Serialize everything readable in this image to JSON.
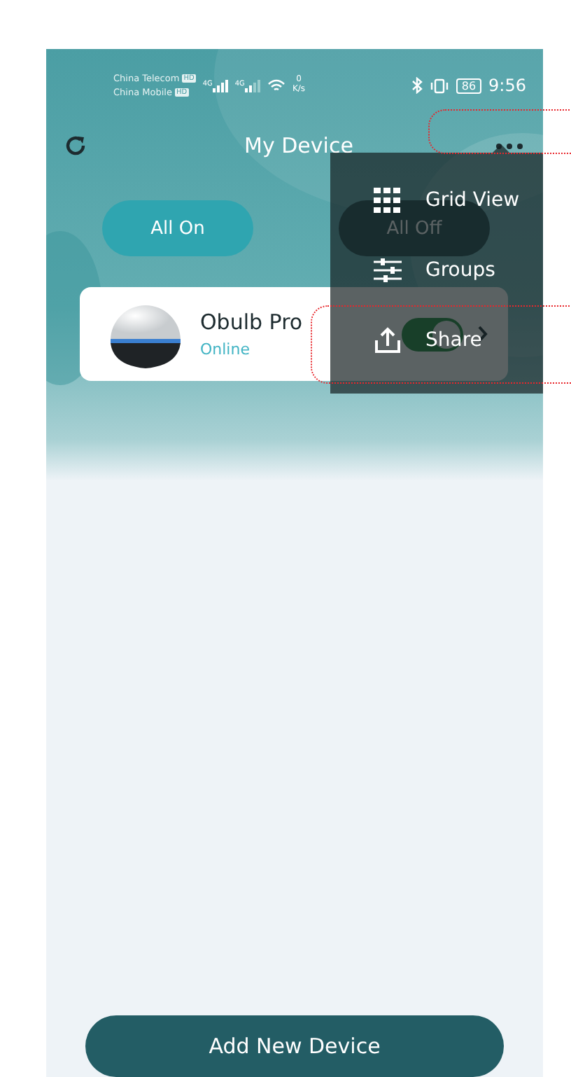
{
  "status_bar": {
    "carriers": [
      {
        "name": "China Telecom",
        "badge": "HD"
      },
      {
        "name": "China Mobile",
        "badge": "HD"
      }
    ],
    "signals": [
      "4G",
      "4G"
    ],
    "speed": "0",
    "speed_unit": "K/s",
    "battery": "86",
    "time": "9:56"
  },
  "header": {
    "title": "My Device"
  },
  "quick_buttons": [
    {
      "label": "All On",
      "kind": "on"
    },
    {
      "label": "All Off",
      "kind": "off"
    }
  ],
  "device": {
    "name": "Obulb Pro",
    "status": "Online",
    "on": true
  },
  "menu": [
    {
      "label": "Grid View",
      "kind": "grid"
    },
    {
      "label": "Groups",
      "kind": "sliders"
    },
    {
      "label": "Share",
      "kind": "share"
    }
  ],
  "add_button": "Add New Device"
}
